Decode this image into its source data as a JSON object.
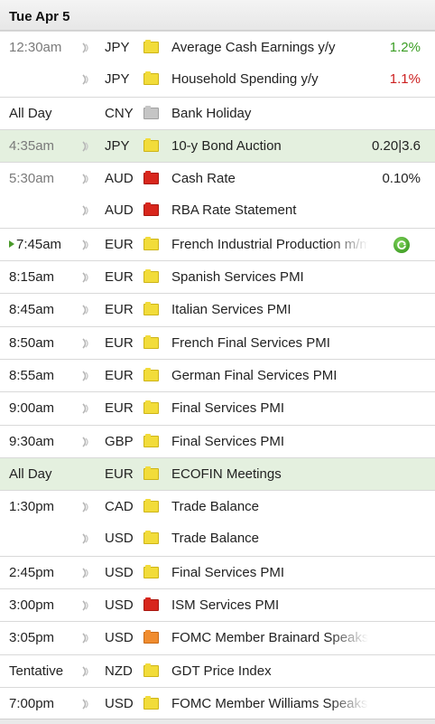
{
  "date_header": "Tue Apr 5",
  "rows": [
    {
      "time": "12:30am",
      "currency": "JPY",
      "impact": "yellow",
      "event": "Average Cash Earnings y/y",
      "actual": "1.2%",
      "actual_dir": "up",
      "speaker": true,
      "time_dim": true,
      "sep": true,
      "hl": false,
      "fade": false
    },
    {
      "time": "",
      "currency": "JPY",
      "impact": "yellow",
      "event": "Household Spending y/y",
      "actual": "1.1%",
      "actual_dir": "down",
      "speaker": true,
      "time_dim": true,
      "sep": false,
      "hl": false,
      "fade": false
    },
    {
      "time": "All Day",
      "currency": "CNY",
      "impact": "gray",
      "event": "Bank Holiday",
      "actual": "",
      "actual_dir": "plain",
      "speaker": false,
      "time_dim": false,
      "sep": true,
      "hl": false,
      "fade": false
    },
    {
      "time": "4:35am",
      "currency": "JPY",
      "impact": "yellow",
      "event": "10-y Bond Auction",
      "actual": "0.20|3.6",
      "actual_dir": "plain",
      "speaker": true,
      "time_dim": true,
      "sep": true,
      "hl": true,
      "fade": false
    },
    {
      "time": "5:30am",
      "currency": "AUD",
      "impact": "red",
      "event": "Cash Rate",
      "actual": "0.10%",
      "actual_dir": "plain",
      "speaker": true,
      "time_dim": true,
      "sep": true,
      "hl": false,
      "fade": false
    },
    {
      "time": "",
      "currency": "AUD",
      "impact": "red",
      "event": "RBA Rate Statement",
      "actual": "",
      "actual_dir": "plain",
      "speaker": true,
      "time_dim": true,
      "sep": false,
      "hl": false,
      "fade": false
    },
    {
      "time": "7:45am",
      "currency": "EUR",
      "impact": "yellow",
      "event": "French Industrial Production m/m",
      "actual": "",
      "actual_dir": "plain",
      "speaker": true,
      "time_dim": false,
      "sep": true,
      "hl": false,
      "fade": true,
      "playing": true,
      "refresh": true
    },
    {
      "time": "8:15am",
      "currency": "EUR",
      "impact": "yellow",
      "event": "Spanish Services PMI",
      "actual": "",
      "actual_dir": "plain",
      "speaker": true,
      "time_dim": false,
      "sep": true,
      "hl": false,
      "fade": false
    },
    {
      "time": "8:45am",
      "currency": "EUR",
      "impact": "yellow",
      "event": "Italian Services PMI",
      "actual": "",
      "actual_dir": "plain",
      "speaker": true,
      "time_dim": false,
      "sep": true,
      "hl": false,
      "fade": false
    },
    {
      "time": "8:50am",
      "currency": "EUR",
      "impact": "yellow",
      "event": "French Final Services PMI",
      "actual": "",
      "actual_dir": "plain",
      "speaker": true,
      "time_dim": false,
      "sep": true,
      "hl": false,
      "fade": false
    },
    {
      "time": "8:55am",
      "currency": "EUR",
      "impact": "yellow",
      "event": "German Final Services PMI",
      "actual": "",
      "actual_dir": "plain",
      "speaker": true,
      "time_dim": false,
      "sep": true,
      "hl": false,
      "fade": false
    },
    {
      "time": "9:00am",
      "currency": "EUR",
      "impact": "yellow",
      "event": "Final Services PMI",
      "actual": "",
      "actual_dir": "plain",
      "speaker": true,
      "time_dim": false,
      "sep": true,
      "hl": false,
      "fade": false
    },
    {
      "time": "9:30am",
      "currency": "GBP",
      "impact": "yellow",
      "event": "Final Services PMI",
      "actual": "",
      "actual_dir": "plain",
      "speaker": true,
      "time_dim": false,
      "sep": true,
      "hl": false,
      "fade": false
    },
    {
      "time": "All Day",
      "currency": "EUR",
      "impact": "yellow",
      "event": "ECOFIN Meetings",
      "actual": "",
      "actual_dir": "plain",
      "speaker": false,
      "time_dim": false,
      "sep": true,
      "hl": true,
      "fade": false
    },
    {
      "time": "1:30pm",
      "currency": "CAD",
      "impact": "yellow",
      "event": "Trade Balance",
      "actual": "",
      "actual_dir": "plain",
      "speaker": true,
      "time_dim": false,
      "sep": true,
      "hl": false,
      "fade": false
    },
    {
      "time": "",
      "currency": "USD",
      "impact": "yellow",
      "event": "Trade Balance",
      "actual": "",
      "actual_dir": "plain",
      "speaker": true,
      "time_dim": false,
      "sep": false,
      "hl": false,
      "fade": false
    },
    {
      "time": "2:45pm",
      "currency": "USD",
      "impact": "yellow",
      "event": "Final Services PMI",
      "actual": "",
      "actual_dir": "plain",
      "speaker": true,
      "time_dim": false,
      "sep": true,
      "hl": false,
      "fade": false
    },
    {
      "time": "3:00pm",
      "currency": "USD",
      "impact": "red",
      "event": "ISM Services PMI",
      "actual": "",
      "actual_dir": "plain",
      "speaker": true,
      "time_dim": false,
      "sep": true,
      "hl": false,
      "fade": false
    },
    {
      "time": "3:05pm",
      "currency": "USD",
      "impact": "orange",
      "event": "FOMC Member Brainard Speaks",
      "actual": "",
      "actual_dir": "plain",
      "speaker": true,
      "time_dim": false,
      "sep": true,
      "hl": false,
      "fade": true
    },
    {
      "time": "Tentative",
      "currency": "NZD",
      "impact": "yellow",
      "event": "GDT Price Index",
      "actual": "",
      "actual_dir": "plain",
      "speaker": true,
      "time_dim": false,
      "sep": true,
      "hl": false,
      "fade": false
    },
    {
      "time": "7:00pm",
      "currency": "USD",
      "impact": "yellow",
      "event": "FOMC Member Williams Speaks",
      "actual": "",
      "actual_dir": "plain",
      "speaker": true,
      "time_dim": false,
      "sep": true,
      "hl": false,
      "fade": true
    }
  ],
  "colors": {
    "highlight_row": "#e4f0df",
    "actual_up": "#3a9d23",
    "actual_down": "#cc1f1f",
    "impact_yellow": "#f2dc3a",
    "impact_red": "#d8261c",
    "impact_orange": "#f08c2e",
    "impact_gray": "#c5c5c5"
  },
  "icons": {
    "speaker": "speaker-icon",
    "impact": "folder-impact-icon",
    "refresh": "refresh-icon",
    "playing": "play-indicator-icon"
  }
}
